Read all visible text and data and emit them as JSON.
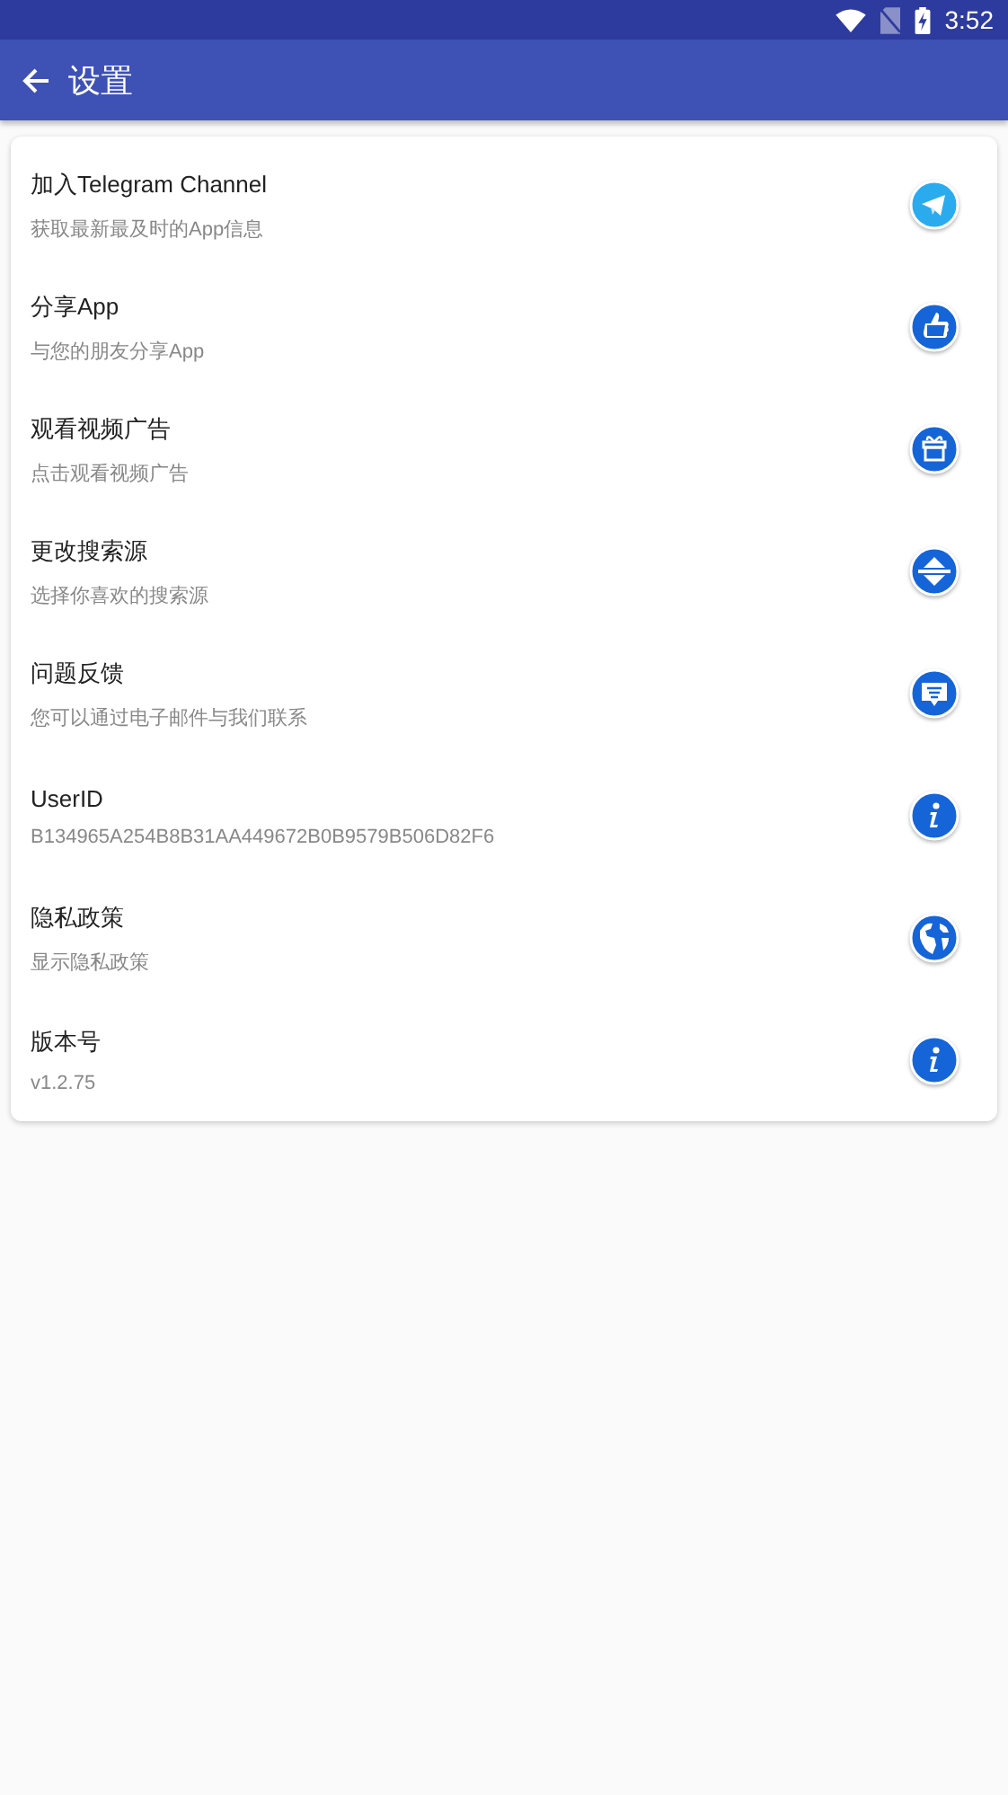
{
  "status_bar": {
    "time": "3:52"
  },
  "toolbar": {
    "title": "设置"
  },
  "items": [
    {
      "title": "加入Telegram Channel",
      "subtitle": "获取最新最及时的App信息"
    },
    {
      "title": "分享App",
      "subtitle": "与您的朋友分享App"
    },
    {
      "title": "观看视频广告",
      "subtitle": "点击观看视频广告"
    },
    {
      "title": "更改搜索源",
      "subtitle": "选择你喜欢的搜索源"
    },
    {
      "title": "问题反馈",
      "subtitle": "您可以通过电子邮件与我们联系"
    },
    {
      "title": "UserID",
      "subtitle": "B134965A254B8B31AA449672B0B9579B506D82F6"
    },
    {
      "title": "隐私政策",
      "subtitle": "显示隐私政策"
    },
    {
      "title": "版本号",
      "subtitle": "v1.2.75"
    }
  ]
}
